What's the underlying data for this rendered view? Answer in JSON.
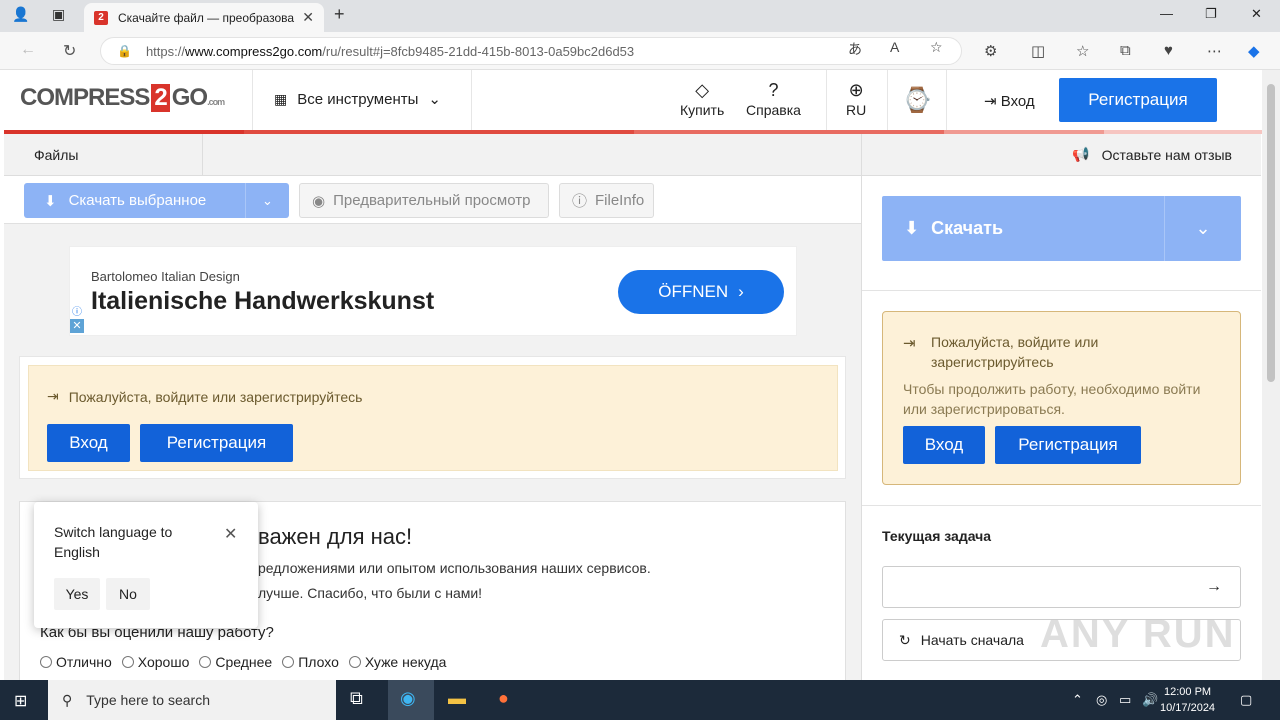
{
  "browser": {
    "tab_title": "Скачайте файл — преобразова",
    "tab_favicon": "2",
    "url_prefix": "https://",
    "url_host": "www.compress2go.com",
    "url_path": "/ru/result#j=8fcb9485-21dd-415b-8013-0a59bc2d6d53"
  },
  "header": {
    "logo_left": "COMPRESS",
    "logo_mid": "2",
    "logo_right": "GO",
    "logo_com": ".com",
    "tools_label": "Все инструменты",
    "buy_label": "Купить",
    "help_label": "Справка",
    "lang_label": "RU",
    "login_label": "Вход",
    "register_label": "Регистрация"
  },
  "left": {
    "files_tab": "Файлы",
    "download_selected": "Скачать выбранное",
    "preview": "Предварительный просмотр",
    "fileinfo": "FileInfo",
    "ad": {
      "brand": "Bartolomeo Italian Design",
      "headline": "Italienische Handwerkskunst",
      "button": "ÖFFNEN"
    },
    "notice": {
      "text": "Пожалуйста, войдите или зарегистрируйтесь",
      "login": "Вход",
      "register": "Регистрация"
    },
    "feedback": {
      "title": "важен для нас!",
      "line1": "редложениями или опытом использования наших сервисов.",
      "line2": "лучше. Спасибо, что были с нами!",
      "question": "Как бы вы оценили нашу работу?",
      "options": [
        "Отлично",
        "Хорошо",
        "Среднее",
        "Плохо",
        "Хуже некуда"
      ]
    },
    "popup": {
      "text": "Switch language to English",
      "yes": "Yes",
      "no": "No"
    }
  },
  "right": {
    "feedback_link": "Оставьте нам отзыв",
    "download": "Скачать",
    "notice_title": "Пожалуйста, войдите или зарегистрируйтесь",
    "notice_body": "Чтобы продолжить работу, необходимо войти или зарегистрироваться.",
    "login": "Вход",
    "register": "Регистрация",
    "task_title": "Текущая задача",
    "restart": "Начать сначала"
  },
  "watermark": "ANY RUN",
  "taskbar": {
    "search_placeholder": "Type here to search",
    "time": "12:00 PM",
    "date": "10/17/2024"
  },
  "colors": {
    "accent_blue": "#1a73e8",
    "brand_red": "#d9342b",
    "notice_bg": "#fdf1d8"
  }
}
